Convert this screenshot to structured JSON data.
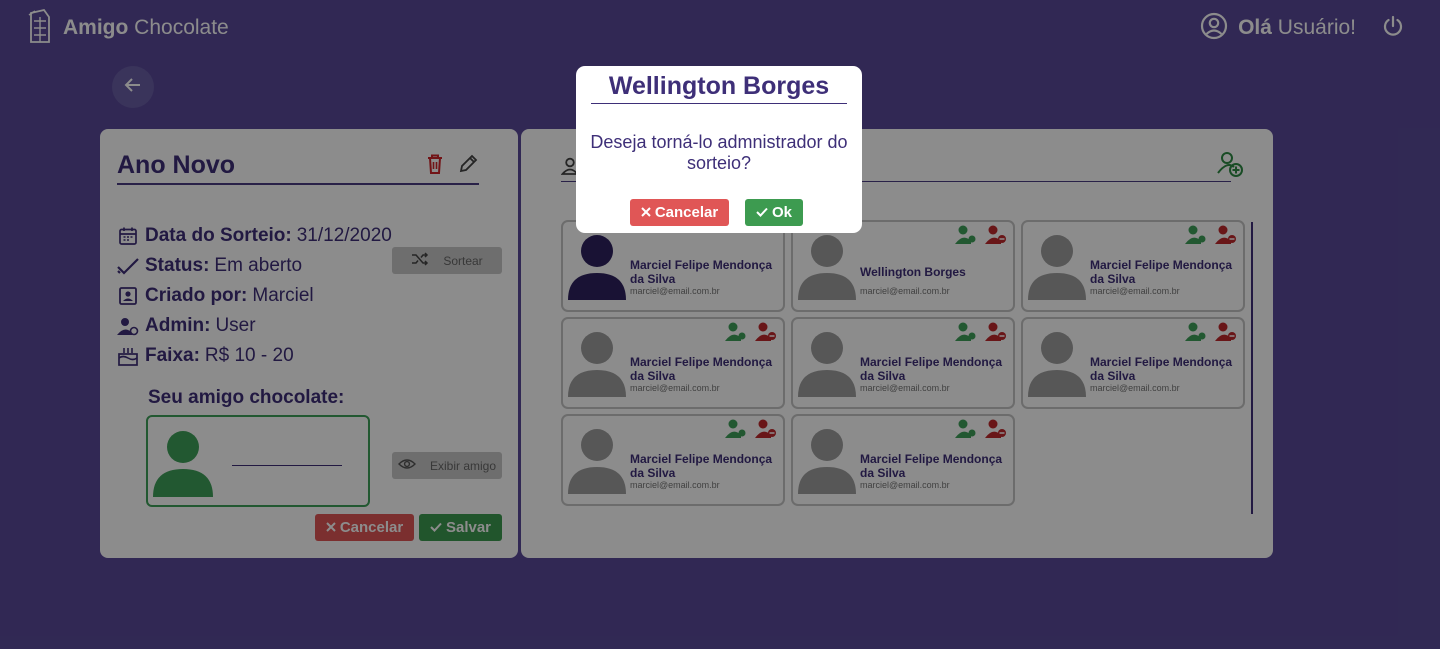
{
  "header": {
    "brand_bold": "Amigo",
    "brand_rest": "Chocolate",
    "greeting_bold": "Olá",
    "greeting_rest": "Usuário!"
  },
  "draw": {
    "title": "Ano Novo",
    "info": [
      {
        "label": "Data do Sorteio:",
        "value": "31/12/2020",
        "icon": "calendar-icon"
      },
      {
        "label": "Status:",
        "value": "Em aberto",
        "icon": "check-icon"
      },
      {
        "label": "Criado por:",
        "value": "Marciel",
        "icon": "badge-icon"
      },
      {
        "label": "Admin:",
        "value": "User",
        "icon": "admin-icon"
      },
      {
        "label": "Faixa:",
        "value": "R$ 10 - 20",
        "icon": "cake-icon"
      }
    ],
    "sortear_label": "Sortear",
    "amigo_label": "Seu amigo chocolate:",
    "exibir_label": "Exibir amigo",
    "cancel_label": "Cancelar",
    "save_label": "Salvar"
  },
  "members": [
    {
      "name": "Marciel Felipe Mendonça da Silva",
      "email": "marciel@email.com.br"
    },
    {
      "name": "Wellington Borges",
      "email": "marciel@email.com.br"
    },
    {
      "name": "Marciel Felipe Mendonça da Silva",
      "email": "marciel@email.com.br"
    },
    {
      "name": "Marciel Felipe Mendonça da Silva",
      "email": "marciel@email.com.br"
    },
    {
      "name": "Marciel Felipe Mendonça da Silva",
      "email": "marciel@email.com.br"
    },
    {
      "name": "Marciel Felipe Mendonça da Silva",
      "email": "marciel@email.com.br"
    },
    {
      "name": "Marciel Felipe Mendonça da Silva",
      "email": "marciel@email.com.br"
    },
    {
      "name": "Marciel Felipe Mendonça da Silva",
      "email": "marciel@email.com.br"
    }
  ],
  "modal": {
    "title": "Wellington Borges",
    "message": "Deseja torná-lo admnistrador do sorteio?",
    "cancel_label": "Cancelar",
    "ok_label": "Ok"
  },
  "colors": {
    "primary": "#5a4a99",
    "text": "#3e2f78",
    "danger": "#e05656",
    "success": "#3d9b50"
  }
}
